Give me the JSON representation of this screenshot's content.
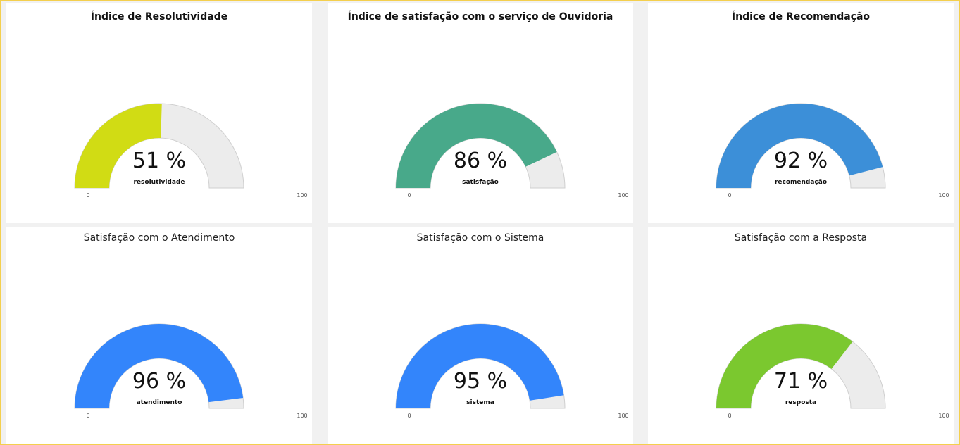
{
  "colors": {
    "frame": "#f4cf4d",
    "track": "#ececec",
    "track_stroke": "#cfcfcf"
  },
  "chart_data": [
    {
      "type": "gauge",
      "title": "Índice de Resolutividade",
      "value": 51,
      "display": "51 %",
      "label": "resolutividade",
      "min": 0,
      "max": 100,
      "min_label": "0",
      "max_label": "100",
      "color": "#d1dc14"
    },
    {
      "type": "gauge",
      "title": "Índice de satisfação com o serviço de Ouvidoria",
      "value": 86,
      "display": "86 %",
      "label": "satisfação",
      "min": 0,
      "max": 100,
      "min_label": "0",
      "max_label": "100",
      "color": "#48a98a"
    },
    {
      "type": "gauge",
      "title": "Índice de Recomendação",
      "value": 92,
      "display": "92 %",
      "label": "recomendação",
      "min": 0,
      "max": 100,
      "min_label": "0",
      "max_label": "100",
      "color": "#3c8fd8"
    },
    {
      "type": "gauge",
      "title": "Satisfação com o Atendimento",
      "value": 96,
      "display": "96 %",
      "label": "atendimento",
      "min": 0,
      "max": 100,
      "min_label": "0",
      "max_label": "100",
      "color": "#3385fb"
    },
    {
      "type": "gauge",
      "title": "Satisfação com o Sistema",
      "value": 95,
      "display": "95 %",
      "label": "sistema",
      "min": 0,
      "max": 100,
      "min_label": "0",
      "max_label": "100",
      "color": "#3385fb"
    },
    {
      "type": "gauge",
      "title": "Satisfação com a Resposta",
      "value": 71,
      "display": "71 %",
      "label": "resposta",
      "min": 0,
      "max": 100,
      "min_label": "0",
      "max_label": "100",
      "color": "#7bc82f"
    }
  ]
}
